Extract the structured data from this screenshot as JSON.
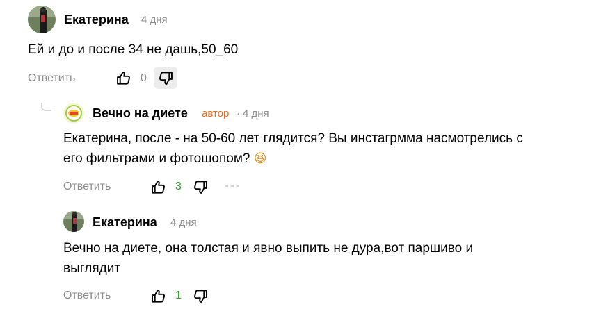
{
  "comments": [
    {
      "author": "Екатерина",
      "time": "4 дня",
      "text": "Ей и до и после 34 не дашь,50_60",
      "reply_label": "Ответить",
      "likes": "0"
    },
    {
      "author": "Вечно на диете",
      "author_tag": "автор",
      "time_sep": "·",
      "time": "4 дня",
      "text_line1": "Екатерина, после - на 50-60 лет глядится? Вы инстагрмма насмотрелись с",
      "text_line2": "его фильтрами и фотошопом?",
      "emoji": "😆",
      "reply_label": "Ответить",
      "likes": "3"
    },
    {
      "author": "Екатерина",
      "time": "4 дня",
      "text_line1": "Вечно на диете, она толстая и явно выпить не дура,вот паршиво и",
      "text_line2": "выглядит",
      "reply_label": "Ответить",
      "likes": "1"
    }
  ],
  "icons": {
    "like": "thumbs-up-icon",
    "dislike": "thumbs-down-icon",
    "more": "more-icon",
    "thread": "thread-connector-icon"
  },
  "colors": {
    "author_tag": "#f0661d",
    "positive_count": "#2aa22a",
    "muted": "#8c8c8c"
  }
}
